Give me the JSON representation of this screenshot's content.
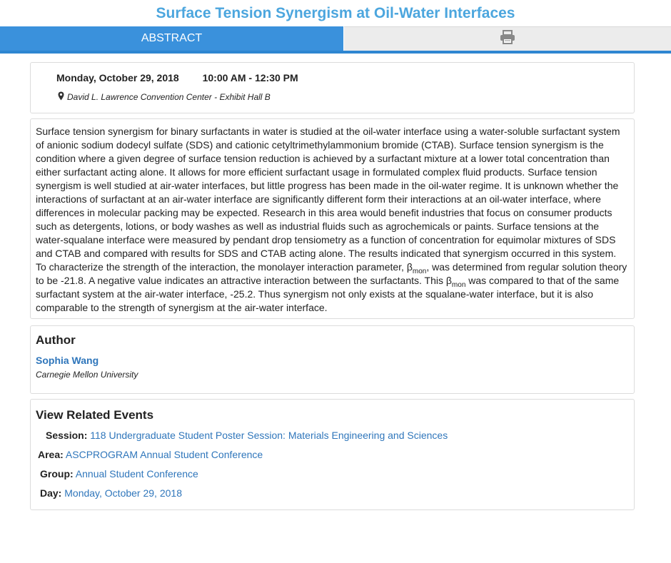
{
  "page": {
    "title": "Surface Tension Synergism at Oil-Water Interfaces"
  },
  "tabs": {
    "abstract_label": "ABSTRACT",
    "print_icon": "printer-icon"
  },
  "when": {
    "date": "Monday, October 29, 2018",
    "time": "10:00 AM - 12:30 PM",
    "location_icon": "map-marker-icon",
    "location": "David L. Lawrence Convention Center - Exhibit Hall B"
  },
  "abstract": {
    "part1": "Surface tension synergism for binary surfactants in water is studied at the oil-water interface using a water-soluble surfactant system of anionic sodium dodecyl sulfate (SDS) and cationic cetyltrimethylammonium bromide (CTAB). Surface tension synergism is the condition where a given degree of surface tension reduction is achieved by a surfactant mixture at a lower total concentration than either surfactant acting alone. It allows for more efficient surfactant usage in formulated complex fluid products. Surface tension synergism is well studied at air-water interfaces, but little progress has been made in the oil-water regime. It is unknown whether the interactions of surfactant at an air-water interface are significantly different form their interactions at an oil-water interface, where differences in molecular packing may be expected. Research in this area would benefit industries that focus on consumer products such as detergents, lotions, or body washes as well as industrial fluids such as agrochemicals or paints. Surface tensions at the water-squalane interface were measured by pendant drop tensiometry as a function of concentration for equimolar mixtures of SDS and CTAB and compared with results for SDS and CTAB acting alone. The results indicated that synergism occurred in this system. To characterize the strength of the interaction, the monolayer interaction parameter, β",
    "sub1": "mon",
    "part2": ", was determined from regular solution theory to be -21.8. A negative value indicates an attractive interaction between the surfactants. This β",
    "sub2": "mon",
    "part3": " was compared to that of the same surfactant system at the air-water interface, -25.2. Thus synergism not only exists at the squalane-water interface, but it is also comparable to the strength of synergism at the air-water interface."
  },
  "author": {
    "heading": "Author",
    "name": "Sophia Wang",
    "affiliation": "Carnegie Mellon University"
  },
  "related": {
    "heading": "View Related Events",
    "items": [
      {
        "label": "Session:",
        "value": "118 Undergraduate Student Poster Session: Materials Engineering and Sciences"
      },
      {
        "label": "Area:",
        "value": "ASCPROGRAM Annual Student Conference"
      },
      {
        "label": "Group:",
        "value": "Annual Student Conference"
      },
      {
        "label": "Day:",
        "value": "Monday, October 29, 2018"
      }
    ]
  }
}
